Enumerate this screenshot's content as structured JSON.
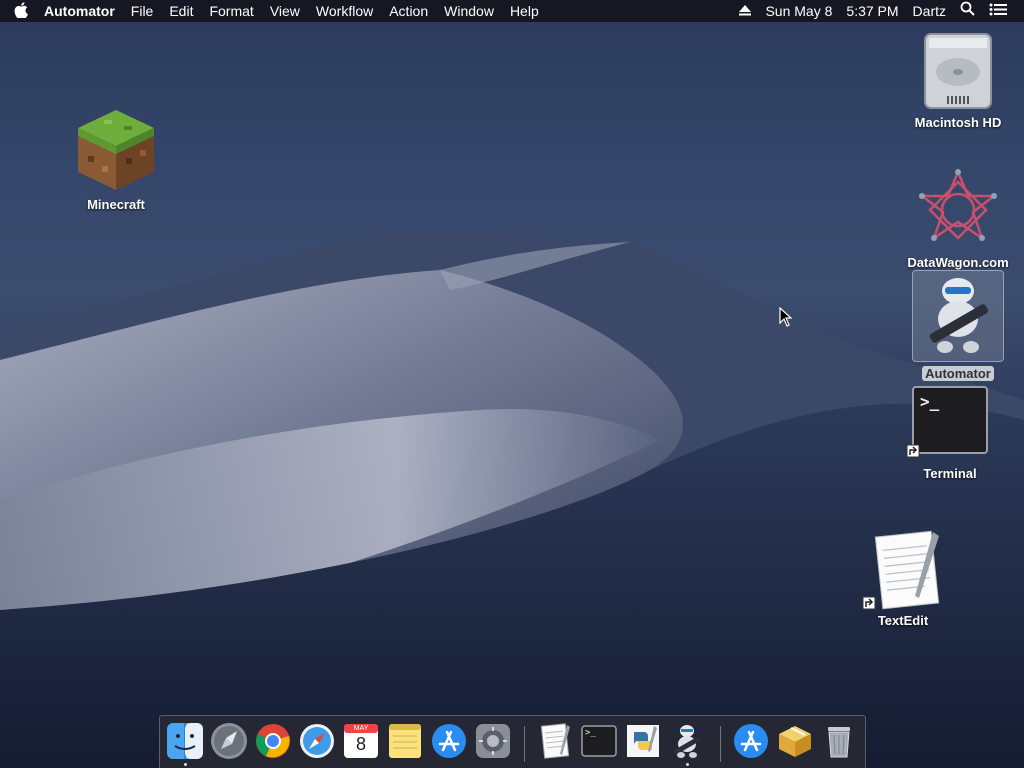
{
  "menubar": {
    "apple_icon": "apple-logo-icon",
    "app_name": "Automator",
    "menus": [
      "File",
      "Edit",
      "Format",
      "View",
      "Workflow",
      "Action",
      "Window",
      "Help"
    ],
    "date": "Sun May 8",
    "time": "5:37 PM",
    "user": "Dartz",
    "eject_icon": "eject-icon",
    "search_icon": "spotlight-search-icon",
    "notifications_icon": "notification-center-icon"
  },
  "desktop_icons": {
    "minecraft": "Minecraft",
    "macintosh_hd": "Macintosh HD",
    "datawagon": "DataWagon.com",
    "automator": "Automator",
    "terminal": "Terminal",
    "terminal_prompt": ">_",
    "textedit": "TextEdit"
  },
  "dock": {
    "calendar_month": "MAY",
    "calendar_day": "8",
    "terminal_prompt": ">_",
    "apps": [
      "Finder",
      "Launchpad",
      "Google Chrome",
      "Safari",
      "Calendar",
      "Notes",
      "App Store",
      "System Preferences",
      "TextEdit",
      "Terminal",
      "Python",
      "Automator",
      "App Store",
      "Archive Utility",
      "Trash"
    ]
  },
  "colors": {
    "sky_top": "#2b3a5c",
    "sky_bottom": "#161d33",
    "menubar_bg": "#14161e",
    "dune_light": "#8c93a8",
    "dock_bg": "#282a34"
  }
}
